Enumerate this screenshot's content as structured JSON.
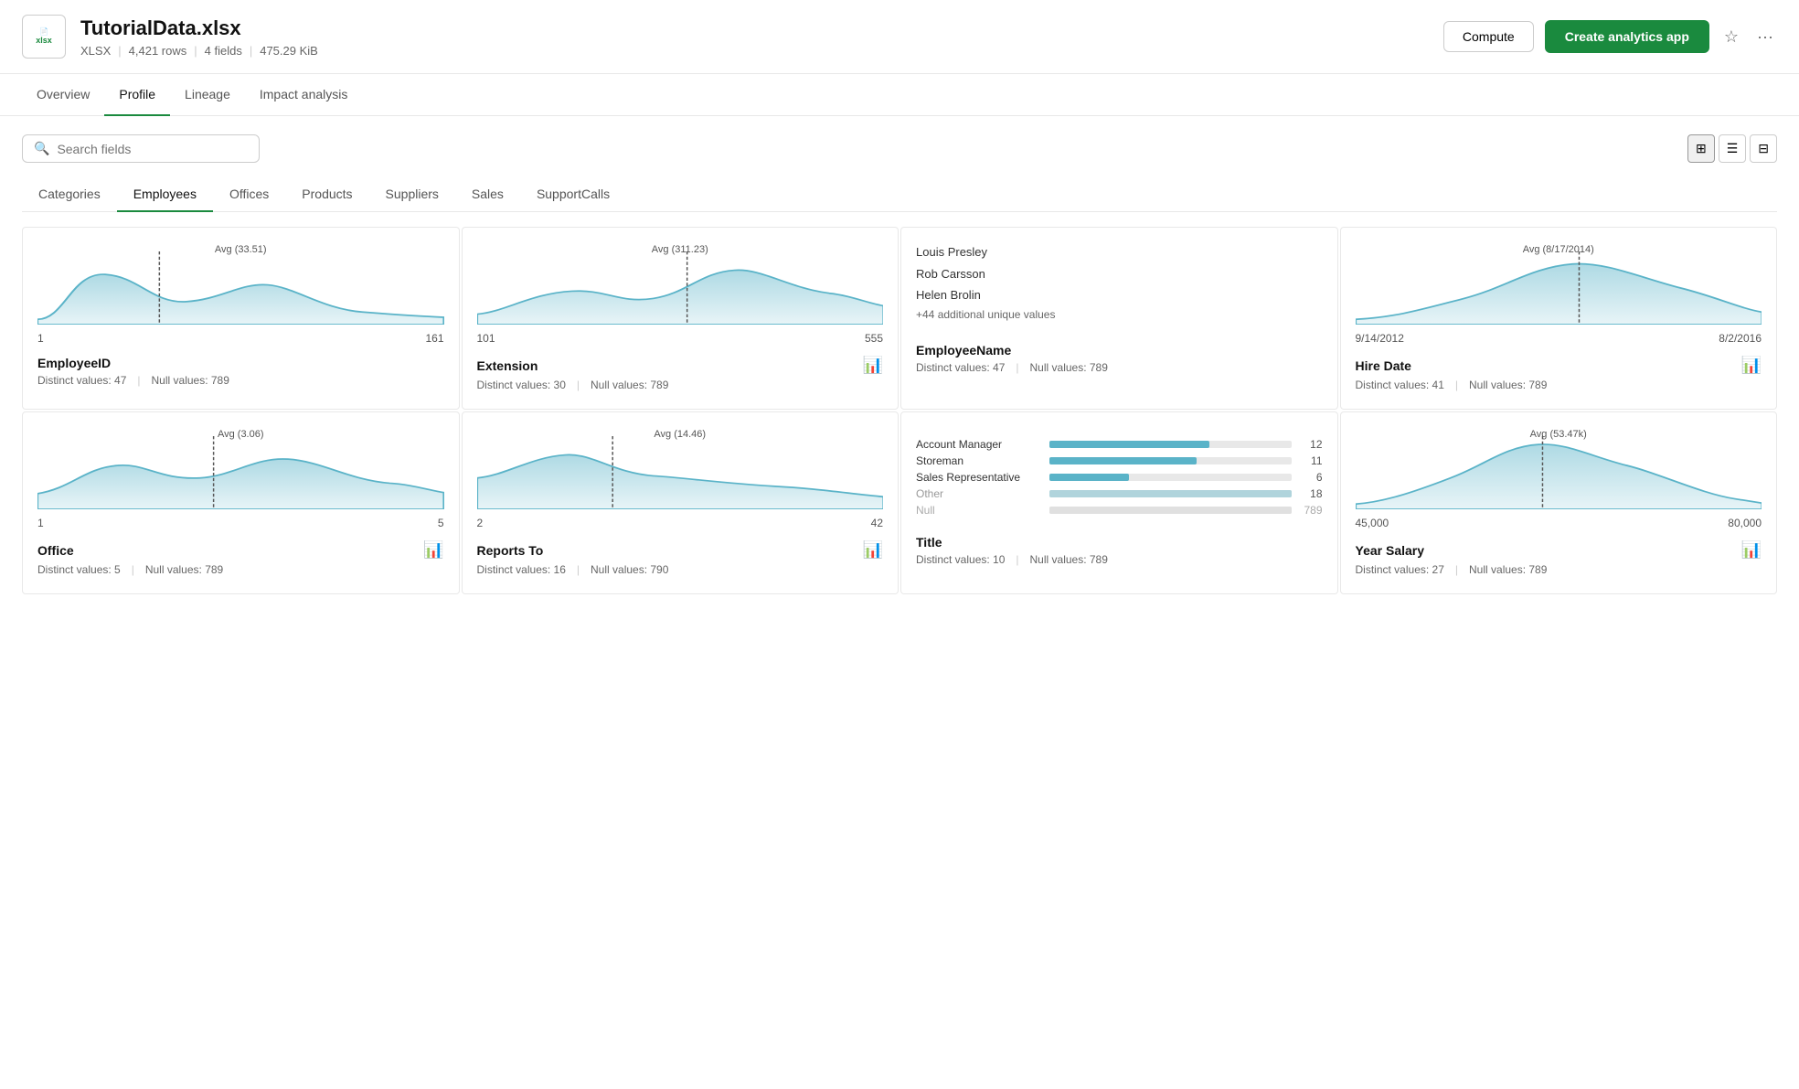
{
  "header": {
    "file_icon_top": "xlsx",
    "file_title": "TutorialData.xlsx",
    "file_type": "XLSX",
    "rows": "4,421 rows",
    "fields": "4 fields",
    "size": "475.29 KiB",
    "btn_compute": "Compute",
    "btn_create": "Create analytics app"
  },
  "nav_tabs": [
    {
      "label": "Overview",
      "active": false
    },
    {
      "label": "Profile",
      "active": true
    },
    {
      "label": "Lineage",
      "active": false
    },
    {
      "label": "Impact analysis",
      "active": false
    }
  ],
  "search": {
    "placeholder": "Search fields"
  },
  "category_tabs": [
    {
      "label": "Categories",
      "active": false
    },
    {
      "label": "Employees",
      "active": true
    },
    {
      "label": "Offices",
      "active": false
    },
    {
      "label": "Products",
      "active": false
    },
    {
      "label": "Suppliers",
      "active": false
    },
    {
      "label": "Sales",
      "active": false
    },
    {
      "label": "SupportCalls",
      "active": false
    }
  ],
  "cards": [
    {
      "id": "employee-id",
      "type": "wave",
      "avg_label": "Avg (33.51)",
      "range_min": "1",
      "range_max": "161",
      "title": "EmployeeID",
      "distinct": "Distinct values: 47",
      "null": "Null values: 789",
      "has_bar_icon": false
    },
    {
      "id": "extension",
      "type": "wave",
      "avg_label": "Avg (311.23)",
      "range_min": "101",
      "range_max": "555",
      "title": "Extension",
      "distinct": "Distinct values: 30",
      "null": "Null values: 789",
      "has_bar_icon": true
    },
    {
      "id": "employee-name",
      "type": "names",
      "names": [
        "Louis Presley",
        "Rob Carsson",
        "Helen Brolin"
      ],
      "additional": "+44 additional unique values",
      "title": "EmployeeName",
      "distinct": "Distinct values: 47",
      "null": "Null values: 789",
      "has_bar_icon": false
    },
    {
      "id": "hire-date",
      "type": "wave",
      "avg_label": "Avg (8/17/2014)",
      "range_min": "9/14/2012",
      "range_max": "8/2/2016",
      "title": "Hire Date",
      "distinct": "Distinct values: 41",
      "null": "Null values: 789",
      "has_bar_icon": true
    },
    {
      "id": "office",
      "type": "wave2",
      "avg_label": "Avg (3.06)",
      "range_min": "1",
      "range_max": "5",
      "title": "Office",
      "distinct": "Distinct values: 5",
      "null": "Null values: 789",
      "has_bar_icon": true
    },
    {
      "id": "reports-to",
      "type": "wave2",
      "avg_label": "Avg (14.46)",
      "range_min": "2",
      "range_max": "42",
      "title": "Reports To",
      "distinct": "Distinct values: 16",
      "null": "Null values: 790",
      "has_bar_icon": true
    },
    {
      "id": "title",
      "type": "bars",
      "bars": [
        {
          "label": "Account Manager",
          "value": 12,
          "max": 18
        },
        {
          "label": "Storeman",
          "value": 11,
          "max": 18
        },
        {
          "label": "Sales Representative",
          "value": 6,
          "max": 18
        },
        {
          "label": "Other",
          "value": 18,
          "max": 18,
          "muted": true
        },
        {
          "label": "Null",
          "value": 789,
          "max": 789,
          "null_val": true
        }
      ],
      "title": "Title",
      "distinct": "Distinct values: 10",
      "null": "Null values: 789",
      "has_bar_icon": false
    },
    {
      "id": "year-salary",
      "type": "wave3",
      "avg_label": "Avg (53.47k)",
      "range_min": "45,000",
      "range_max": "80,000",
      "title": "Year Salary",
      "distinct": "Distinct values: 27",
      "null": "Null values: 789",
      "has_bar_icon": true
    }
  ]
}
